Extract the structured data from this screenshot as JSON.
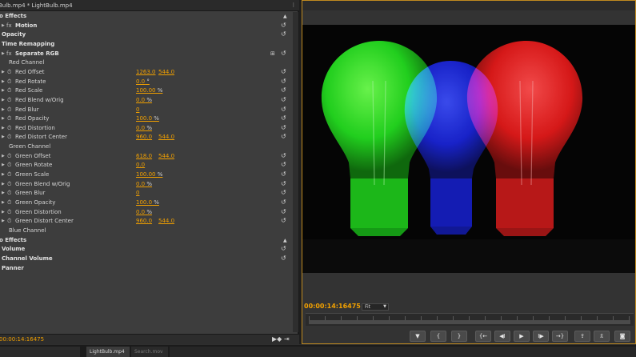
{
  "effect_controls": {
    "tab_title": "Bulb.mp4 * LightBulb.mp4",
    "timecode": "00:00:14:16475",
    "rows": [
      {
        "label": "o Effects",
        "type": "section",
        "bold": true,
        "up": true
      },
      {
        "label": "Motion",
        "type": "effect",
        "bold": true,
        "reset": true
      },
      {
        "label": "Opacity",
        "type": "effect2",
        "bold": true,
        "reset": true
      },
      {
        "label": "Time Remapping",
        "type": "effect2",
        "bold": true
      },
      {
        "label": "Separate RGB",
        "type": "effect",
        "bold": true,
        "reset": true,
        "extra": "⊞"
      },
      {
        "label": "Red Channel",
        "type": "group"
      },
      {
        "label": "Red Offset",
        "type": "prop",
        "v1": "1263.0",
        "v2": "544.0",
        "reset": true
      },
      {
        "label": "Red Rotate",
        "type": "prop",
        "v1": "0.0",
        "unit": " °",
        "reset": true
      },
      {
        "label": "Red Scale",
        "type": "prop",
        "v1": "100.00",
        "unit": " %",
        "reset": true
      },
      {
        "label": "Red Blend w/Orig",
        "type": "prop",
        "v1": "0.0",
        "unit": " %",
        "reset": true
      },
      {
        "label": "Red Blur",
        "type": "prop",
        "v1": "0",
        "reset": true
      },
      {
        "label": "Red Opacity",
        "type": "prop",
        "v1": "100.0",
        "unit": " %",
        "reset": true
      },
      {
        "label": "Red Distortion",
        "type": "prop",
        "v1": "0.0",
        "unit": " %",
        "reset": true
      },
      {
        "label": "Red Distort Center",
        "type": "prop",
        "v1": "960.0",
        "v2": "544.0",
        "reset": true
      },
      {
        "label": "Green Channel",
        "type": "group"
      },
      {
        "label": "Green Offset",
        "type": "prop",
        "v1": "618.0",
        "v2": "544.0",
        "reset": true
      },
      {
        "label": "Green Rotate",
        "type": "prop",
        "v1": "0.0",
        "reset": true
      },
      {
        "label": "Green Scale",
        "type": "prop",
        "v1": "100.00",
        "unit": " %",
        "reset": true
      },
      {
        "label": "Green Blend w/Orig",
        "type": "prop",
        "v1": "0.0",
        "unit": " %",
        "reset": true
      },
      {
        "label": "Green Blur",
        "type": "prop",
        "v1": "0",
        "reset": true
      },
      {
        "label": "Green Opacity",
        "type": "prop",
        "v1": "100.0",
        "unit": " %",
        "reset": true
      },
      {
        "label": "Green Distortion",
        "type": "prop",
        "v1": "0.0",
        "unit": " %",
        "reset": true
      },
      {
        "label": "Green Distort Center",
        "type": "prop",
        "v1": "960.0",
        "v2": "544.0",
        "reset": true
      },
      {
        "label": "Blue Channel",
        "type": "group"
      },
      {
        "label": "o Effects",
        "type": "section",
        "bold": true,
        "up": true
      },
      {
        "label": "Volume",
        "type": "effect2",
        "bold": true,
        "reset": true
      },
      {
        "label": "Channel Volume",
        "type": "effect2",
        "bold": true,
        "reset": true
      },
      {
        "label": "Panner",
        "type": "effect2",
        "bold": true
      }
    ]
  },
  "program_monitor": {
    "timecode": "00:00:14:16475",
    "fit_label": "Fit",
    "transport_buttons": [
      {
        "icon": "marker-icon",
        "glyph": "▼"
      },
      {
        "icon": "mark-in-icon",
        "glyph": "{"
      },
      {
        "icon": "mark-out-icon",
        "glyph": "}"
      },
      {
        "icon": "go-to-in-icon",
        "glyph": "{←"
      },
      {
        "icon": "step-back-icon",
        "glyph": "◀I"
      },
      {
        "icon": "play-icon",
        "glyph": "▶"
      },
      {
        "icon": "step-forward-icon",
        "glyph": "I▶"
      },
      {
        "icon": "go-to-out-icon",
        "glyph": "→}"
      },
      {
        "icon": "lift-icon",
        "glyph": "⇪"
      },
      {
        "icon": "extract-icon",
        "glyph": "⇫"
      },
      {
        "icon": "export-frame-icon",
        "glyph": "◙"
      }
    ]
  },
  "bottom_tabs": {
    "tab_active": "LightBulb.mp4",
    "tab_inactive": "Search.mov"
  },
  "colors": {
    "accent_timecode": "#f1a000",
    "bulb_green": "#2cff1a",
    "bulb_blue": "#1a2aff",
    "bulb_red": "#ff1a1a"
  }
}
